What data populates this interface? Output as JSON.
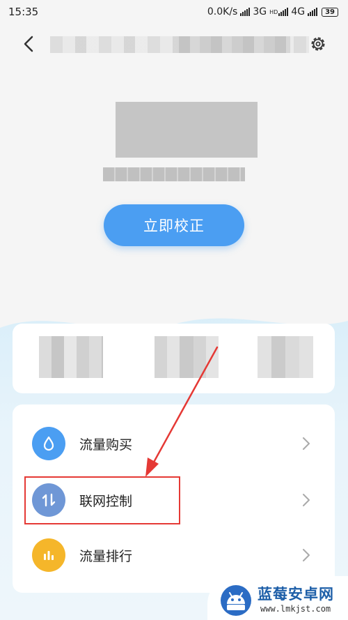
{
  "status_bar": {
    "time": "15:35",
    "net_speed": "0.0K/s",
    "network_3g": "3G",
    "network_4g": "4G",
    "hd_label": "HD",
    "battery": "39"
  },
  "header": {
    "back_icon": "chevron-left-icon",
    "settings_icon": "gear-icon"
  },
  "calibrate_button": {
    "label": "立即校正"
  },
  "menu": {
    "items": [
      {
        "label": "流量购买",
        "icon": "drop-icon",
        "color": "#4b9ef2"
      },
      {
        "label": "联网控制",
        "icon": "transfer-arrows-icon",
        "color": "#6f97d6"
      },
      {
        "label": "流量排行",
        "icon": "bar-chart-icon",
        "color": "#f5b62a"
      }
    ]
  },
  "watermark": {
    "name": "蓝莓安卓网",
    "url": "www.lmkjst.com"
  },
  "colors": {
    "accent": "#4b9ef2",
    "annotation": "#e53935"
  }
}
